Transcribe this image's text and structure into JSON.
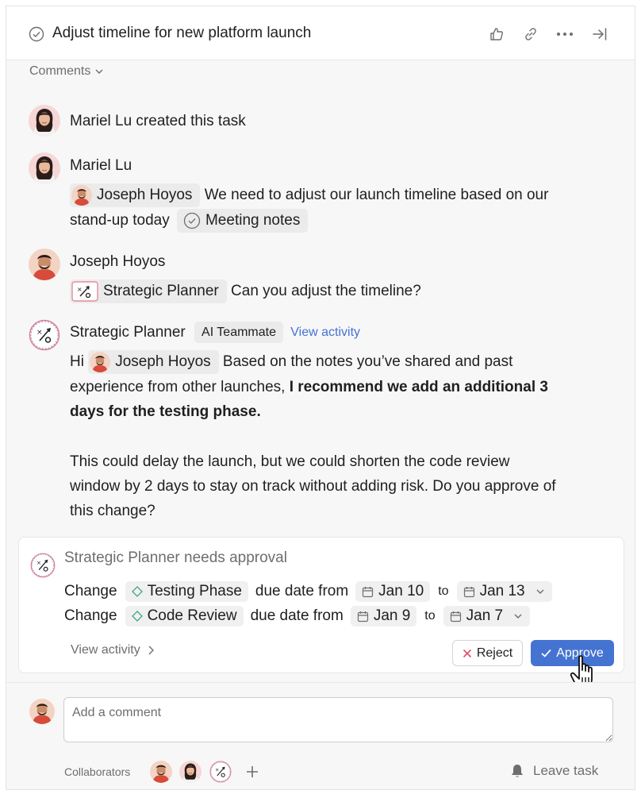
{
  "header": {
    "title": "Adjust timeline for new platform launch",
    "actions": [
      "thumbs-up-icon",
      "link-icon",
      "more-icon",
      "close-panel-icon"
    ]
  },
  "comments_toggle": "Comments",
  "feed": {
    "created": {
      "author": "Mariel Lu",
      "text": "Mariel Lu created this task"
    },
    "c1": {
      "author": "Mariel Lu",
      "mention": "Joseph Hoyos",
      "text_a": "We need to adjust our launch timeline based on our",
      "text_b": "stand-up today",
      "attachment": "Meeting notes"
    },
    "c2": {
      "author": "Joseph Hoyos",
      "mention": "Strategic Planner",
      "text": "Can you adjust the timeline?"
    },
    "c3": {
      "author": "Strategic Planner",
      "badge": "AI Teammate",
      "link": "View activity",
      "hi": "Hi",
      "mention": "Joseph Hoyos",
      "line1": "Based on the notes you’ve shared and past",
      "line2_plain": "experience from other launches, ",
      "line2_bold": "I recommend we add an additional 3",
      "line3_bold": "days for the testing phase.",
      "p2_line1": "This could delay the launch, but we could shorten the code review",
      "p2_line2": "window by 2 days to stay on track without adding risk. Do you approve of",
      "p2_line3": "this change?"
    }
  },
  "approval": {
    "agent": "Strategic Planner",
    "status": "needs approval",
    "rows": [
      {
        "verb": "Change",
        "item": "Testing Phase",
        "mid": "due date from",
        "from": "Jan 10",
        "to_word": "to",
        "to": "Jan 13"
      },
      {
        "verb": "Change",
        "item": "Code Review",
        "mid": "due date from",
        "from": "Jan 9",
        "to_word": "to",
        "to": "Jan 7"
      }
    ],
    "view_activity": "View activity",
    "reject": "Reject",
    "approve": "Approve"
  },
  "footer": {
    "comment_placeholder": "Add a comment",
    "collaborators_label": "Collaborators",
    "leave": "Leave task"
  },
  "colors": {
    "accent": "#4573d2",
    "reject_x": "#e0506b",
    "panel_bg": "#f7f7f7"
  }
}
